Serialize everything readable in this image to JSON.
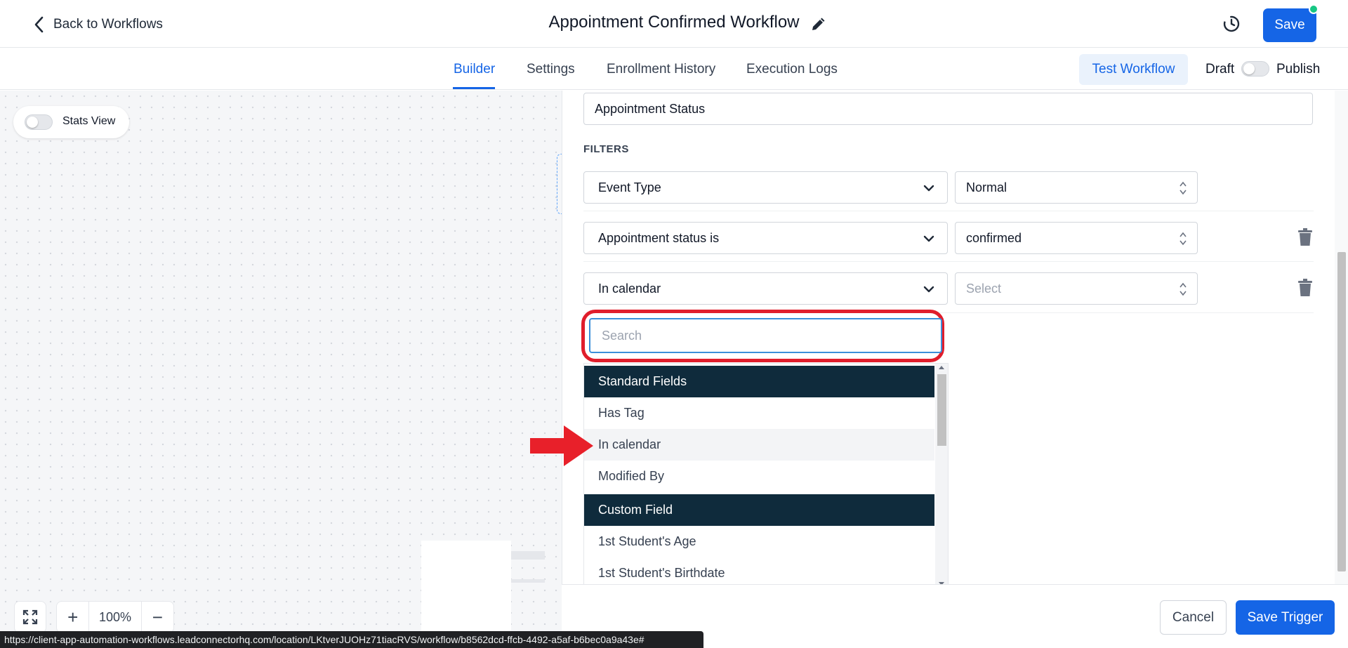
{
  "header": {
    "back_label": "Back to Workflows",
    "workflow_title": "Appointment Confirmed Workflow",
    "save_label": "Save"
  },
  "tabs": [
    {
      "label": "Builder",
      "active": true
    },
    {
      "label": "Settings",
      "active": false
    },
    {
      "label": "Enrollment History",
      "active": false
    },
    {
      "label": "Execution Logs",
      "active": false
    }
  ],
  "toolbar": {
    "test_workflow_label": "Test Workflow",
    "draft_label": "Draft",
    "publish_label": "Publish",
    "publish_enabled": false
  },
  "canvas": {
    "stats_view_label": "Stats View",
    "stats_view_enabled": false,
    "zoom_level": "100%",
    "zoom_in_symbol": "+",
    "zoom_out_symbol": "−"
  },
  "trigger_panel": {
    "trigger_name": "Appointment Status",
    "filters_heading": "FILTERS",
    "filters": [
      {
        "field": "Event Type",
        "value": "Normal",
        "is_placeholder": false,
        "deletable": false
      },
      {
        "field": "Appointment status is",
        "value": "confirmed",
        "is_placeholder": false,
        "deletable": true
      },
      {
        "field": "In calendar",
        "value": "Select",
        "is_placeholder": true,
        "deletable": true
      }
    ],
    "dropdown": {
      "search_placeholder": "Search",
      "groups": [
        {
          "label": "Standard Fields",
          "items": [
            "Has Tag",
            "In calendar",
            "Modified By"
          ]
        },
        {
          "label": "Custom Field",
          "items": [
            "1st Student's Age",
            "1st Student's Birthdate"
          ]
        }
      ],
      "highlighted_item": "In calendar"
    },
    "cancel_label": "Cancel",
    "save_trigger_label": "Save Trigger"
  },
  "annotations": {
    "highlight_color": "#e01d2b",
    "arrow_color": "#e8202a"
  },
  "status_bar_url": "https://client-app-automation-workflows.leadconnectorhq.com/location/LKtverJUOHz71tiacRVS/workflow/b8562dcd-ffcb-4492-a5af-b6bec0a9a43e#",
  "colors": {
    "primary": "#1565e6",
    "group_header_bg": "#0f2b3c",
    "status_online": "#16c784"
  }
}
